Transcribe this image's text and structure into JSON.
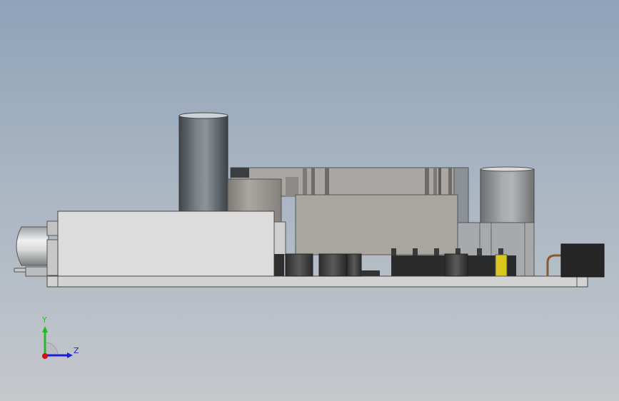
{
  "viewport": {
    "background_top": "#8ea3ba",
    "background_bottom": "#c5c8cb"
  },
  "model": {
    "view": "side",
    "icon": "pcb-assembly-model"
  },
  "triad": {
    "icon": "coordinate-triad-icon",
    "y_label": "Y",
    "z_label": "Z",
    "y_color": "#1fbf1f",
    "z_color": "#2020d0",
    "x_color": "#d01010"
  }
}
